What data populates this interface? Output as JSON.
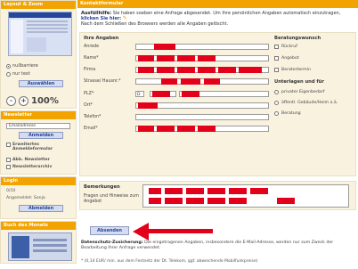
{
  "sidebar": {
    "layout_title": "Layout & Zoom",
    "radio_barrierefrei": "nullbarriere",
    "radio_text": "nur text",
    "select_button": "Auswählen",
    "zoom_out": "-",
    "zoom_in": "+",
    "zoom_level": "100%",
    "newsletter_title": "Newsletter",
    "email_value": "Emailadresse",
    "subscribe_button": "Anmelden",
    "extended_label": "Erweitertes Anmeldeformular",
    "unsubscribe_label": "Abb. Newsletter",
    "archive_label": "Newsletterarchiv",
    "login_title": "Login",
    "login_pages": "0/10",
    "login_user": "Angemeldet: Sonja",
    "logout_button": "Abmelden",
    "book_title": "Buch des Monats"
  },
  "main": {
    "title": "Kontaktformular",
    "intro_bold": "Ausfüllhilfe:",
    "intro_text": " Sie haben soeben eine Anfrage abgesendet. Um Ihre persönlichen Angaben automatisch einzutragen,",
    "intro_link": "klicken Sie hier:",
    "intro_text2": "Nach dem Schließen des Browsers werden alle Angaben gelöscht.",
    "section_left": "Ihre Angaben",
    "section_right": "Beratungswunsch",
    "fields": [
      {
        "label": "Anrede"
      },
      {
        "label": "Name*"
      },
      {
        "label": "Firma"
      },
      {
        "label": "Strasse/ Hausnr.*"
      },
      {
        "label": "PLZ*"
      },
      {
        "label": "Ort*"
      },
      {
        "label": "Telefon*"
      },
      {
        "label": "Email*"
      }
    ],
    "plz_prefix": "D",
    "checks": [
      "Rückruf",
      "Angebot",
      "Beratertermin"
    ],
    "section_right2": "Unterlagen und für",
    "radios": [
      "privater Eigenbedarf",
      "öffentl. Gebäude/Heim o.ä.",
      "Beratung"
    ],
    "remarks_title": "Bemerkungen",
    "remarks_label": "Fragen und Hinweise zum Angebot",
    "send_button": "Absenden",
    "privacy_bold": "Datenschutz-Zusicherung:",
    "privacy_text": " Die eingetragenen Angaben, insbesondere die E-Mail-Adresse, werden nur zum Zweck der Bearbeitung Ihrer Anfrage verwendet.",
    "footnote": "* (0,14 EUR/ min. aus dem Festnetz der Dt. Telekom, ggf. abweichende Mobilfunkpreise)"
  },
  "colors": {
    "header_orange": "#f3a300",
    "redaction_red": "#e3001b",
    "panel_beige": "#f9f2df",
    "link_blue": "#25479b"
  }
}
